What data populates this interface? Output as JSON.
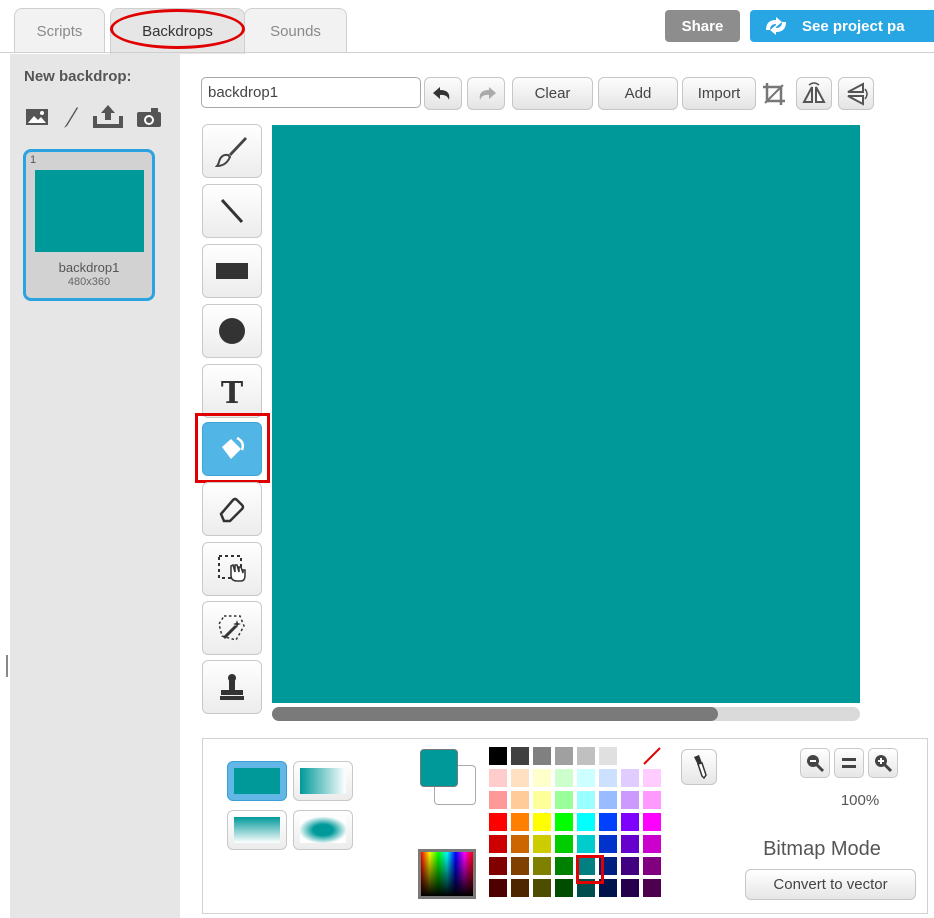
{
  "tabs": [
    {
      "label": "Scripts",
      "active": false
    },
    {
      "label": "Backdrops",
      "active": true
    },
    {
      "label": "Sounds",
      "active": false
    }
  ],
  "header": {
    "share_label": "Share",
    "see_project_label": "See project pa"
  },
  "left_panel": {
    "new_backdrop_label": "New backdrop:",
    "new_backdrop_icons": [
      "choose-from-library-icon",
      "paint-new-icon",
      "upload-file-icon",
      "camera-icon"
    ],
    "backdrops": [
      {
        "number": "1",
        "name": "backdrop1",
        "size": "480x360",
        "color": "#00999a"
      }
    ]
  },
  "toolbar": {
    "name_value": "backdrop1",
    "clear_label": "Clear",
    "add_label": "Add",
    "import_label": "Import"
  },
  "tools": [
    {
      "name": "brush",
      "selected": false
    },
    {
      "name": "line",
      "selected": false
    },
    {
      "name": "rectangle",
      "selected": false
    },
    {
      "name": "ellipse",
      "selected": false
    },
    {
      "name": "text",
      "selected": false
    },
    {
      "name": "fill",
      "selected": true
    },
    {
      "name": "eraser",
      "selected": false
    },
    {
      "name": "select",
      "selected": false
    },
    {
      "name": "magic-select",
      "selected": false
    },
    {
      "name": "stamp",
      "selected": false
    }
  ],
  "canvas": {
    "fill_color": "#00999a"
  },
  "bottom": {
    "primary_color": "#00999a",
    "secondary_color": "#ffffff",
    "zoom_level": "100%",
    "mode_label": "Bitmap Mode",
    "convert_label": "Convert to vector",
    "selected_palette_color": "#008080"
  },
  "palette": [
    [
      "#000000",
      "#404040",
      "#808080",
      "#a0a0a0",
      "#c0c0c0",
      "#e0e0e0",
      "#ffffff",
      "none"
    ],
    [
      "#ffcccc",
      "#ffe0c0",
      "#ffffcc",
      "#ccffcc",
      "#ccffff",
      "#cce0ff",
      "#e0ccff",
      "#ffccff"
    ],
    [
      "#ff9999",
      "#ffcc99",
      "#ffff99",
      "#99ff99",
      "#99ffff",
      "#99bbff",
      "#cc99ff",
      "#ff99ff"
    ],
    [
      "#ff0000",
      "#ff8000",
      "#ffff00",
      "#00ff00",
      "#00ffff",
      "#0040ff",
      "#8000ff",
      "#ff00ff"
    ],
    [
      "#cc0000",
      "#cc6600",
      "#cccc00",
      "#00cc00",
      "#00cccc",
      "#0033cc",
      "#6600cc",
      "#cc00cc"
    ],
    [
      "#800000",
      "#804000",
      "#808000",
      "#008000",
      "#008080",
      "#002080",
      "#400080",
      "#800080"
    ],
    [
      "#4d0000",
      "#4d2600",
      "#4d4d00",
      "#004d00",
      "#004d4d",
      "#00134d",
      "#26004d",
      "#4d004d"
    ]
  ]
}
